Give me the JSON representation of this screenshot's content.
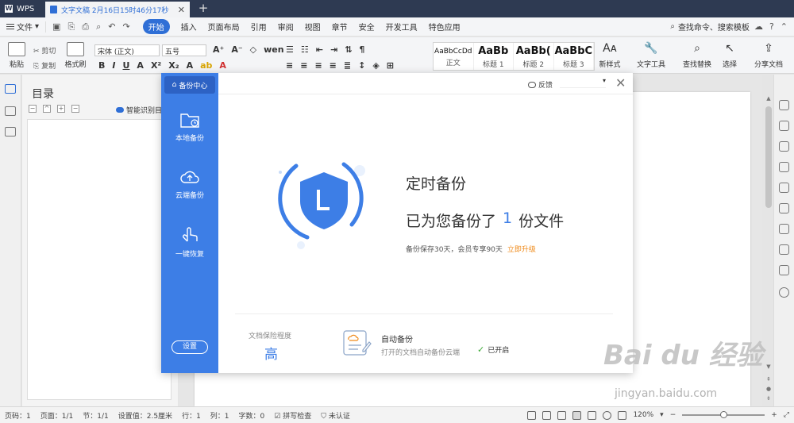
{
  "colors": {
    "accent": "#3d7ee6",
    "titlebar": "#2e3a52",
    "upgrade": "#ef8a1a",
    "enabled": "#3aaa35"
  },
  "tabs": {
    "app": "WPS",
    "document": "文字文稿 2月16日15时46分17秒"
  },
  "menubar": {
    "file": "文件",
    "items": [
      "开始",
      "插入",
      "页面布局",
      "引用",
      "审阅",
      "视图",
      "章节",
      "安全",
      "开发工具",
      "特色应用"
    ],
    "search": "查找命令、搜索模板"
  },
  "ribbon": {
    "paste": "粘贴",
    "cut": "剪切",
    "copy": "复制",
    "format_painter": "格式刷",
    "font": "宋体 (正文)",
    "size": "五号",
    "styles": [
      {
        "preview": "AaBbCcDd",
        "name": "正文"
      },
      {
        "preview": "AaBb",
        "name": "标题 1"
      },
      {
        "preview": "AaBb(",
        "name": "标题 2"
      },
      {
        "preview": "AaBbC",
        "name": "标题 3"
      }
    ],
    "new_style": "新样式",
    "text_tools": "文字工具",
    "find_replace": "查找替换",
    "select": "选择",
    "share": "分享文档"
  },
  "toc": {
    "title": "目录",
    "smart": "智能识别目"
  },
  "dialog": {
    "sidebar": {
      "header": "备份中心",
      "items": [
        "本地备份",
        "云端备份",
        "一键恢复"
      ],
      "settings": "设置"
    },
    "feedback": "反馈",
    "title": "定时备份",
    "status_prefix": "已为您备份了",
    "status_count": "1",
    "status_suffix": "份文件",
    "note": "备份保存30天，会员专享90天",
    "upgrade": "立即升级",
    "protection_label": "文档保险程度",
    "protection_value": "高",
    "auto_title": "自动备份",
    "auto_desc": "打开的文档自动备份云端",
    "auto_status": "已开启"
  },
  "statusbar": {
    "page_no": "页码：1",
    "pages": "页面：1/1",
    "section": "节：1/1",
    "setting": "设置值：2.5厘米",
    "row": "行：1",
    "col": "列：1",
    "words": "字数：0",
    "spell": "拼写检查",
    "cert": "未认证",
    "zoom": "120%"
  },
  "watermark": {
    "main": "Bai du 经验",
    "sub": "jingyan.baidu.com"
  }
}
